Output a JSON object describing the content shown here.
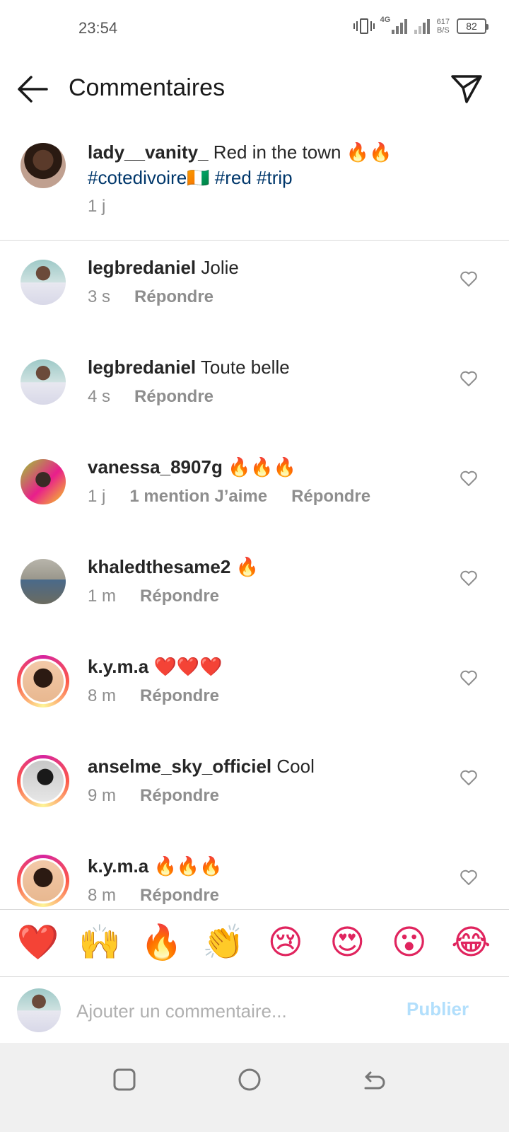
{
  "status_bar": {
    "time": "23:54",
    "network": "4G",
    "speed_value": "617",
    "speed_unit": "B/S",
    "battery": "82"
  },
  "header": {
    "title": "Commentaires",
    "back_icon": "arrow-left",
    "send_icon": "paper-plane"
  },
  "caption": {
    "username": "lady__vanity_",
    "text": "Red in the town 🔥🔥",
    "hashtags": "#cotedivoire🇨🇮 #red #trip",
    "time": "1 j"
  },
  "comments": [
    {
      "username": "legbredaniel",
      "text": "Jolie",
      "time": "3 s",
      "likes": "",
      "reply": "Répondre"
    },
    {
      "username": "legbredaniel",
      "text": "Toute belle",
      "time": "4 s",
      "likes": "",
      "reply": "Répondre"
    },
    {
      "username": "vanessa_8907g",
      "text": "🔥🔥🔥",
      "time": "1 j",
      "likes": "1 mention J’aime",
      "reply": "Répondre"
    },
    {
      "username": "khaledthesame2",
      "text": "🔥",
      "time": "1 m",
      "likes": "",
      "reply": "Répondre"
    },
    {
      "username": "k.y.m.a",
      "text": "❤️❤️❤️",
      "time": "8 m",
      "likes": "",
      "reply": "Répondre"
    },
    {
      "username": "anselme_sky_officiel",
      "text": "Cool",
      "time": "9 m",
      "likes": "",
      "reply": "Répondre"
    },
    {
      "username": "k.y.m.a",
      "text": "🔥🔥🔥",
      "time": "8 m",
      "likes": "",
      "reply": "Répondre"
    }
  ],
  "emoji_bar": [
    "❤️",
    "🙌",
    "🔥",
    "👏",
    "😢",
    "😍",
    "😮",
    "😂"
  ],
  "composer": {
    "placeholder": "Ajouter un commentaire...",
    "publish_label": "Publier"
  },
  "colors": {
    "hashtag": "#00376b",
    "secondary_text": "#8e8e8e",
    "publish_disabled": "#b2dffc",
    "divider": "#dbdbdb"
  }
}
